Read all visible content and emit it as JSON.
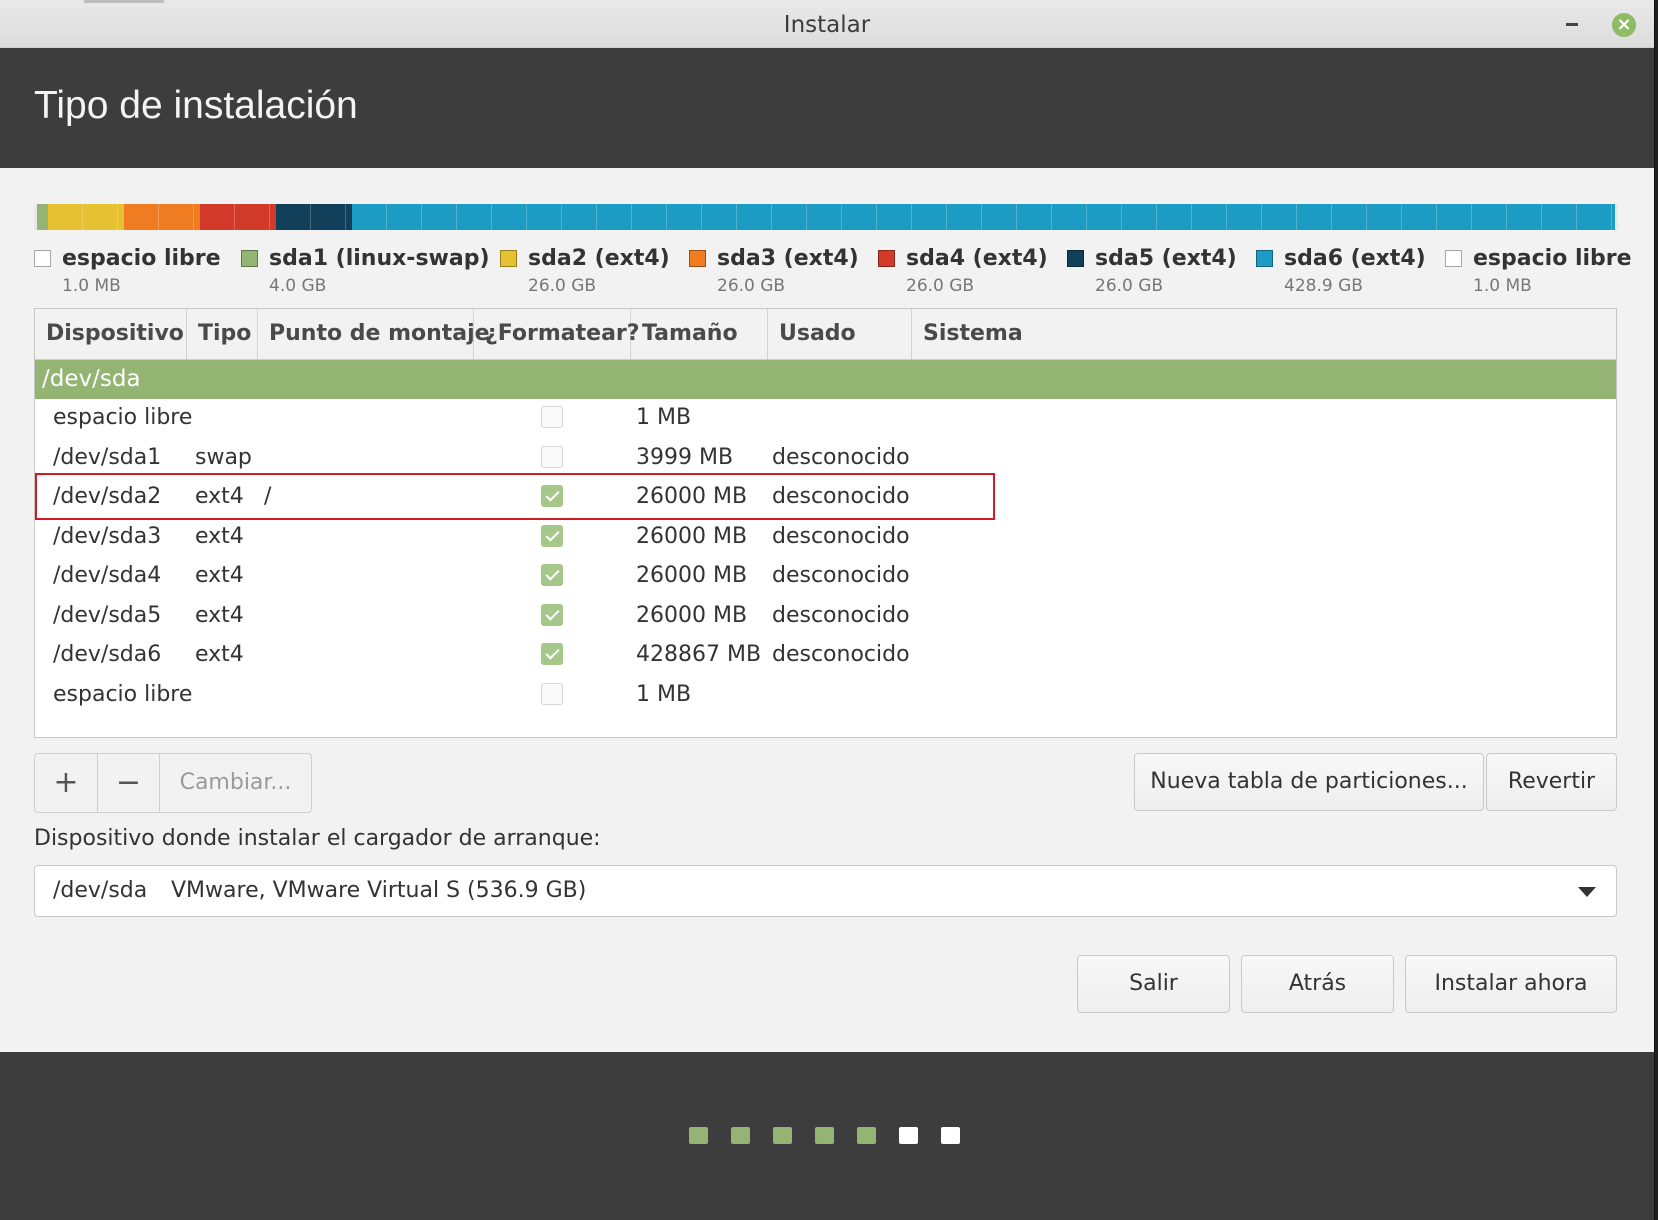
{
  "window": {
    "title": "Instalar"
  },
  "page": {
    "title": "Tipo de instalación"
  },
  "partition_bar": [
    {
      "name": "espacio libre",
      "color": "#e8e8e8",
      "share": 0.002
    },
    {
      "name": "sda1 (linux-swap)",
      "color": "#94b474",
      "share": 0.007
    },
    {
      "name": "sda2 (ext4)",
      "color": "#e6c233",
      "share": 0.048
    },
    {
      "name": "sda3 (ext4)",
      "color": "#f07c21",
      "share": 0.048
    },
    {
      "name": "sda4 (ext4)",
      "color": "#d23b2a",
      "share": 0.048
    },
    {
      "name": "sda5 (ext4)",
      "color": "#123f5a",
      "share": 0.048
    },
    {
      "name": "sda6 (ext4)",
      "color": "#1c9cc4",
      "share": 0.799
    },
    {
      "name": "espacio libre",
      "color": "#e8e8e8",
      "share": 0.002
    }
  ],
  "legend": [
    {
      "name": "espacio libre",
      "size": "1.0 MB",
      "color": "#ffffff"
    },
    {
      "name": "sda1 (linux-swap)",
      "size": "4.0 GB",
      "color": "#94b474"
    },
    {
      "name": "sda2 (ext4)",
      "size": "26.0 GB",
      "color": "#e6c233"
    },
    {
      "name": "sda3 (ext4)",
      "size": "26.0 GB",
      "color": "#f07c21"
    },
    {
      "name": "sda4 (ext4)",
      "size": "26.0 GB",
      "color": "#d23b2a"
    },
    {
      "name": "sda5 (ext4)",
      "size": "26.0 GB",
      "color": "#123f5a"
    },
    {
      "name": "sda6 (ext4)",
      "size": "428.9 GB",
      "color": "#1c9cc4"
    },
    {
      "name": "espacio libre",
      "size": "1.0 MB",
      "color": "#ffffff"
    }
  ],
  "table": {
    "columns": [
      "Dispositivo",
      "Tipo",
      "Punto de montaje",
      "¿Formatear?",
      "Tamaño",
      "Usado",
      "Sistema"
    ],
    "group": "/dev/sda",
    "rows": [
      {
        "device": "espacio libre",
        "type": "",
        "mount": "",
        "format": false,
        "size": "1 MB",
        "used": "",
        "system": ""
      },
      {
        "device": "/dev/sda1",
        "type": "swap",
        "mount": "",
        "format": false,
        "size": "3999 MB",
        "used": "desconocido",
        "system": ""
      },
      {
        "device": "/dev/sda2",
        "type": "ext4",
        "mount": "/",
        "format": true,
        "size": "26000 MB",
        "used": "desconocido",
        "system": ""
      },
      {
        "device": "/dev/sda3",
        "type": "ext4",
        "mount": "",
        "format": true,
        "size": "26000 MB",
        "used": "desconocido",
        "system": ""
      },
      {
        "device": "/dev/sda4",
        "type": "ext4",
        "mount": "",
        "format": true,
        "size": "26000 MB",
        "used": "desconocido",
        "system": ""
      },
      {
        "device": "/dev/sda5",
        "type": "ext4",
        "mount": "",
        "format": true,
        "size": "26000 MB",
        "used": "desconocido",
        "system": ""
      },
      {
        "device": "/dev/sda6",
        "type": "ext4",
        "mount": "",
        "format": true,
        "size": "428867 MB",
        "used": "desconocido",
        "system": ""
      },
      {
        "device": "espacio libre",
        "type": "",
        "mount": "",
        "format": false,
        "size": "1 MB",
        "used": "",
        "system": ""
      }
    ]
  },
  "toolbar": {
    "add_label": "+",
    "remove_label": "−",
    "change_label": "Cambiar...",
    "new_table_label": "Nueva tabla de particiones...",
    "revert_label": "Revertir"
  },
  "bootloader": {
    "label": "Dispositivo donde instalar el cargador de arranque:",
    "device": "/dev/sda",
    "description": "VMware, VMware Virtual S (536.9 GB)"
  },
  "actions": {
    "quit_label": "Salir",
    "back_label": "Atrás",
    "install_label": "Instalar ahora"
  },
  "progress": {
    "total_steps": 7,
    "completed_steps": 5,
    "done_color": "#94b474",
    "pending_color": "#ffffff"
  }
}
